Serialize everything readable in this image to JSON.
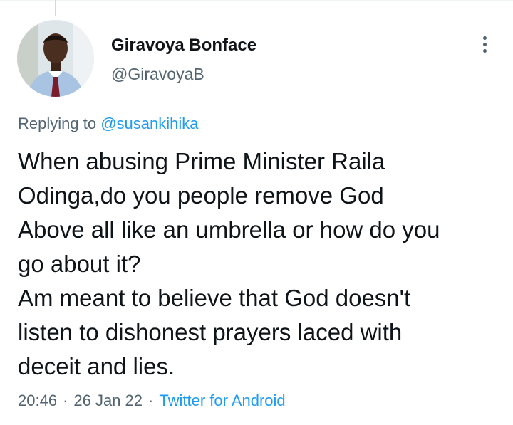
{
  "tweet": {
    "author": {
      "display_name": "Giravoya Bonface",
      "handle": "@GiravoyaB"
    },
    "replying_prefix": "Replying to",
    "replying_to": "@susankihika",
    "lines": [
      "When abusing Prime Minister Raila",
      "Odinga,do you people remove God",
      "Above all like an umbrella or how do you",
      "go about it?",
      "Am meant to believe that God doesn't",
      "listen to dishonest prayers laced with",
      "deceit and lies."
    ],
    "time": "20:46",
    "separator": "·",
    "date": "26 Jan 22",
    "source": "Twitter for Android"
  },
  "colors": {
    "text": "#0f1419",
    "secondary": "#536471",
    "link": "#1d9bf0"
  },
  "icons": {
    "more": "more-vertical-icon"
  }
}
